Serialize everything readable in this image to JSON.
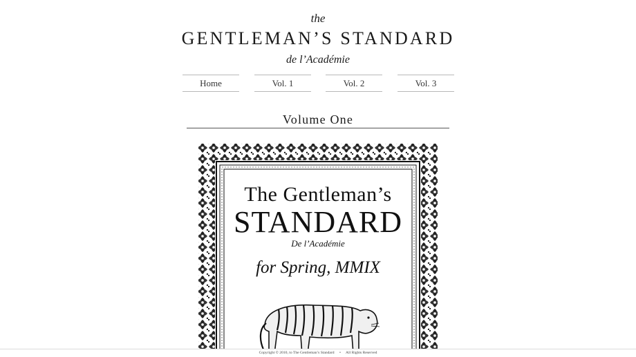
{
  "masthead": {
    "the": "the",
    "title": "GENTLEMAN’S STANDARD",
    "subtitle": "de l’Académie"
  },
  "nav": {
    "items": [
      {
        "label": "Home"
      },
      {
        "label": "Vol. 1"
      },
      {
        "label": "Vol. 2"
      },
      {
        "label": "Vol. 3"
      }
    ]
  },
  "main": {
    "section_title": "Volume One"
  },
  "cover": {
    "line1": "The Gentleman’s",
    "line2": "STANDARD",
    "line3": "De l’Académie",
    "line4": "for Spring, MMIX",
    "illustration": "tiger"
  },
  "footer": {
    "copyright": "Copyright © 2010, to The Gentleman’s Standard",
    "separator": "•",
    "rights": "All Rights Reserved"
  }
}
